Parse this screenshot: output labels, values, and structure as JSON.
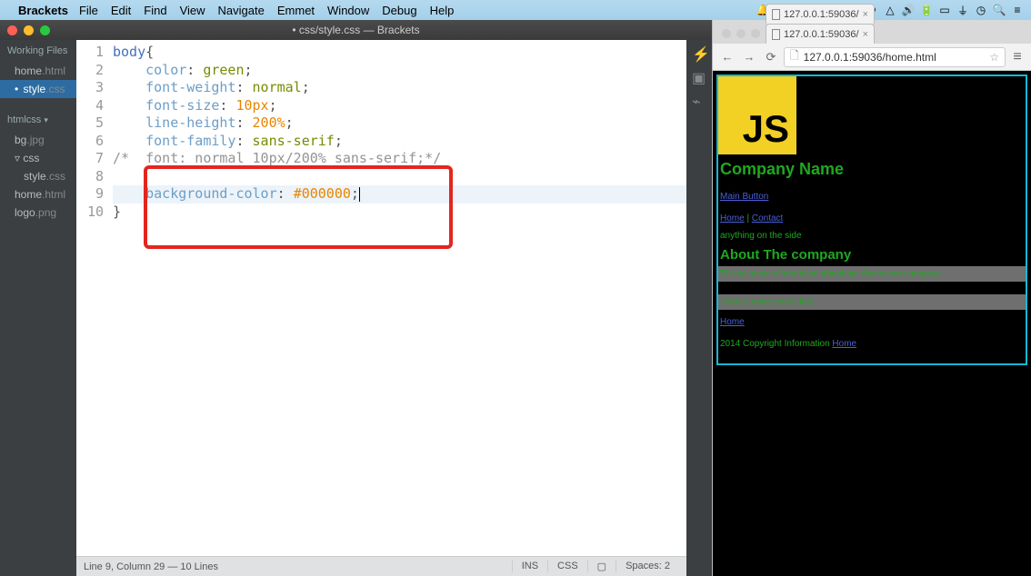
{
  "mac_menu": {
    "app": "Brackets",
    "items": [
      "File",
      "Edit",
      "Find",
      "View",
      "Navigate",
      "Emmet",
      "Window",
      "Debug",
      "Help"
    ]
  },
  "brackets": {
    "title": "• css/style.css — Brackets",
    "working_files_label": "Working Files",
    "working_files": [
      {
        "name": "home",
        "ext": ".html"
      },
      {
        "name": "style",
        "ext": ".css",
        "active": true,
        "dirty": true
      }
    ],
    "project_label": "htmlcss",
    "tree": [
      {
        "name": "bg",
        "ext": ".jpg",
        "indent": 0
      },
      {
        "name": "css",
        "ext": "",
        "indent": 0,
        "folder": true
      },
      {
        "name": "style",
        "ext": ".css",
        "indent": 1
      },
      {
        "name": "home",
        "ext": ".html",
        "indent": 0
      },
      {
        "name": "logo",
        "ext": ".png",
        "indent": 0
      }
    ],
    "code_lines": [
      {
        "n": 1,
        "segs": [
          {
            "t": "body",
            "c": "sel"
          },
          {
            "t": "{",
            "c": "pun"
          }
        ]
      },
      {
        "n": 2,
        "segs": [
          {
            "t": "    "
          },
          {
            "t": "color",
            "c": "prop"
          },
          {
            "t": ": ",
            "c": "pun"
          },
          {
            "t": "green",
            "c": "kw"
          },
          {
            "t": ";",
            "c": "pun"
          }
        ]
      },
      {
        "n": 3,
        "segs": [
          {
            "t": "    "
          },
          {
            "t": "font-weight",
            "c": "prop"
          },
          {
            "t": ": ",
            "c": "pun"
          },
          {
            "t": "normal",
            "c": "kw"
          },
          {
            "t": ";",
            "c": "pun"
          }
        ]
      },
      {
        "n": 4,
        "segs": [
          {
            "t": "    "
          },
          {
            "t": "font-size",
            "c": "prop"
          },
          {
            "t": ": ",
            "c": "pun"
          },
          {
            "t": "10px",
            "c": "num"
          },
          {
            "t": ";",
            "c": "pun"
          }
        ]
      },
      {
        "n": 5,
        "segs": [
          {
            "t": "    "
          },
          {
            "t": "line-height",
            "c": "prop"
          },
          {
            "t": ": ",
            "c": "pun"
          },
          {
            "t": "200%",
            "c": "num"
          },
          {
            "t": ";",
            "c": "pun"
          }
        ]
      },
      {
        "n": 6,
        "segs": [
          {
            "t": "    "
          },
          {
            "t": "font-family",
            "c": "prop"
          },
          {
            "t": ": ",
            "c": "pun"
          },
          {
            "t": "sans-serif",
            "c": "kw"
          },
          {
            "t": ";",
            "c": "pun"
          }
        ]
      },
      {
        "n": 7,
        "segs": [
          {
            "t": "/*  font: normal 10px/200% sans-serif;*/",
            "c": "com"
          }
        ]
      },
      {
        "n": 8,
        "segs": [
          {
            "t": " "
          }
        ]
      },
      {
        "n": 9,
        "hl": true,
        "cursor": true,
        "segs": [
          {
            "t": "    "
          },
          {
            "t": "background-color",
            "c": "prop"
          },
          {
            "t": ": ",
            "c": "pun"
          },
          {
            "t": "#000000",
            "c": "str"
          },
          {
            "t": ";",
            "c": "pun"
          }
        ]
      },
      {
        "n": 10,
        "segs": [
          {
            "t": "}",
            "c": "pun"
          }
        ]
      }
    ],
    "status_left": "Line 9, Column 29 — 10 Lines",
    "status_ins": "INS",
    "status_lang": "CSS",
    "status_err": "▢",
    "status_spaces": "Spaces: 2"
  },
  "chrome": {
    "tabs": [
      {
        "label": "127.0.0.1:59036/"
      },
      {
        "label": "127.0.0.1:59036/"
      }
    ],
    "url": "127.0.0.1:59036/home.html"
  },
  "page": {
    "logo": "JS",
    "company": "Company Name",
    "main_button": "Main Button",
    "nav_home": "Home",
    "nav_sep": " | ",
    "nav_contact": "Contact",
    "side_text": "anything on the side",
    "about": "About The company",
    "info1": "This is some information about our Awesome company",
    "info2": "Here is some more info",
    "footer_home": "Home",
    "copyright": "2014 Copyright Information ",
    "copy_link": "Home"
  }
}
